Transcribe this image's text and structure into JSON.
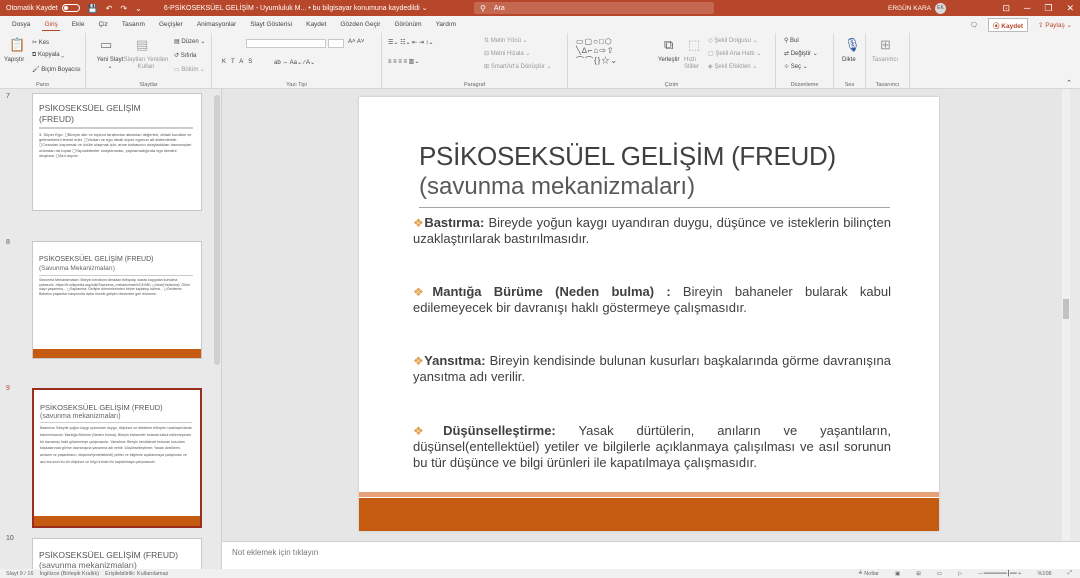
{
  "titlebar": {
    "autosave_label": "Otomatik Kaydet",
    "toggle_state": "Kapalı",
    "doc_title": "6-PSİKOSEKSÜEL GELİŞİM - Uyumluluk M... • bu bilgisayar konumuna kaydedildi ⌄",
    "search_placeholder": "Ara",
    "user_name": "ERGÜN KARA",
    "user_initials": "EK"
  },
  "menu": {
    "tabs": [
      "Dosya",
      "Giriş",
      "Ekle",
      "Çiz",
      "Tasarım",
      "Geçişler",
      "Animasyonlar",
      "Slayt Gösterisi",
      "Kaydet",
      "Gözden Geçir",
      "Görünüm",
      "Yardım"
    ],
    "active_tab": "Giriş",
    "save_label": "⦿ Kaydet",
    "share_label": "⇪ Paylaş ⌄"
  },
  "ribbon": {
    "pano": {
      "paste": "Yapıştır",
      "cut": "✂ Kes",
      "copy": "⧉ Kopyala ⌄",
      "format": "🖌 Biçim Boyacısı",
      "label": "Pano"
    },
    "slaytlar": {
      "new_slide": "Yeni Slayt ⌄",
      "reuse": "Slaytları Yeniden Kullan",
      "layout": "▤ Düzen ⌄",
      "reset": "↺ Sıfırla",
      "section": "▭ Bölüm ⌄",
      "label": "Slaytlar"
    },
    "yazitipi": {
      "bold": "K",
      "italic": "T",
      "underline": "A",
      "strike": "S",
      "label": "Yazı Tipi"
    },
    "paragraf": {
      "text_dir": "⇅ Metin Yönü ⌄",
      "align": "⊟ Metni Hizala ⌄",
      "smartart": "⊞ SmartArt'a Dönüştür ⌄",
      "label": "Paragraf"
    },
    "cizim": {
      "arrange": "Yerleştir",
      "quick_styles": "Hızlı Stiller",
      "fill": "◇ Şekil Dolgusu ⌄",
      "outline": "▢ Şekil Ana Hattı ⌄",
      "effects": "◈ Şekil Efektleri ⌄",
      "label": "Çizim"
    },
    "duzenleme": {
      "find": "⚲ Bul",
      "replace": "⇄ Değiştir ⌄",
      "select": "⊹ Seç ⌄",
      "label": "Düzenleme"
    },
    "ses": {
      "dictate": "Dikte",
      "label": "Ses"
    },
    "tasarimci": {
      "designer": "Tasarımcı",
      "label": "Tasarımcı"
    }
  },
  "thumbnails": [
    {
      "num": "7",
      "title": "PSİKOSEKSÜEL GELİŞİM",
      "sub": "(FREUD)",
      "body": "3. Süper Ego: ◻Bireyin aile ve toplum tarafından aktarılan değerleri, ahlaki kuralları ve geleneklerini temsil eder. ◻Vicdan ve ego ideali süper egonun alt sistemleridir. ◻Cezadan kaçınmak ve ödüle ulaşmak için, anne babasının onayladıkları davranışları onlardan da toplar ◻Yapılabilenler onaylanması, yapılamadığında ego idealini oluşturur ◻Akıl dışıdır."
    },
    {
      "num": "8",
      "title": "PSİKOSEKSÜEL GELİŞİM (FREUD)",
      "sub": "(Savunma Mekanizmaları)",
      "body": "Savunma Mekanizmaları: Bireyin kendisini olmadan bilinçdışı olarak kaygıdan kurtulma çabasıdır. https://tr.wikipedia.org/wiki/Savunma_mekanizmas%C4%B1 ◻Inkar(Yadsıma): Ölüm olayı yaşanmış... ◻Saplanma: Gelişim dönemlerinden birine saplanıp kalma... ◻Gerileme: Bebeksi yaşamlar karşısında daha önceki gelişim dönemine geri dönmesi."
    },
    {
      "num": "9",
      "title": "PSİKOSEKSÜEL GELİŞİM (FREUD)",
      "sub": "(savunma mekanizmaları)",
      "body": "Bastırma: Bireyde yoğun kaygı uyandıran duygu, düşünce ve isteklerin bilinçten uzaklaştırılarak bastırılmasıdır. Mantığa Bürüme (Neden bulma): Bireyin bahaneler bularak kabul edilemeyecek bir davranışı haklı göstermeye çalışmasıdır. Yansıtma: Bireyin kendisinde bulunan kusurları başkalarında görme davranışına yansıtma adı verilir. Düşünselleştirme: Yasak dürtülerin, anıların ve yaşantıların, düşünsel(entellektüel) yetiler ve bilgilerle açıklanmaya çalışılması ve asıl sorunun bu tür düşünce ve bilgi ürünleri ile kapatılmaya çalışmasıdır."
    },
    {
      "num": "10",
      "title": "PSİKOSEKSÜEL GELİŞİM (FREUD)",
      "sub": "(savunma mekanizmaları)",
      "body": ""
    }
  ],
  "slide": {
    "title": "PSİKOSEKSÜEL GELİŞİM (FREUD)",
    "subtitle": "(savunma mekanizmaları)",
    "bullets": [
      {
        "term": "Bastırma:",
        "text": " Bireyde yoğun kaygı uyandıran duygu, düşünce ve isteklerin bilinçten uzaklaştırılarak bastırılmasıdır."
      },
      {
        "term": "Mantığa Bürüme (Neden bulma) :",
        "text": " Bireyin bahaneler bularak kabul edilemeyecek bir davranışı haklı göstermeye çalışmasıdır."
      },
      {
        "term": "Yansıtma:",
        "text": " Bireyin kendisinde bulunan kusurları başkalarında görme davranışına yansıtma adı verilir."
      },
      {
        "term": "Düşünselleştirme:",
        "text": " Yasak dürtülerin, anıların ve yaşantıların, düşünsel(entellektüel) yetiler ve bilgilerle açıklanmaya çalışılması ve asıl sorunun bu tür düşünce ve bilgi ürünleri ile kapatılmaya çalışmasıdır."
      }
    ],
    "bullet_icon": "❖",
    "accent": "#c55a11"
  },
  "notes": {
    "placeholder": "Not eklemek için tıklayın"
  },
  "status": {
    "slide_count": "Slayt 9 / 16",
    "language": "İngilizce (Birleşik Krallık)",
    "accessibility": "Erişilebilirlik: Kullanılamaz",
    "notes": "≜ Notlar",
    "zoom": "%108"
  }
}
